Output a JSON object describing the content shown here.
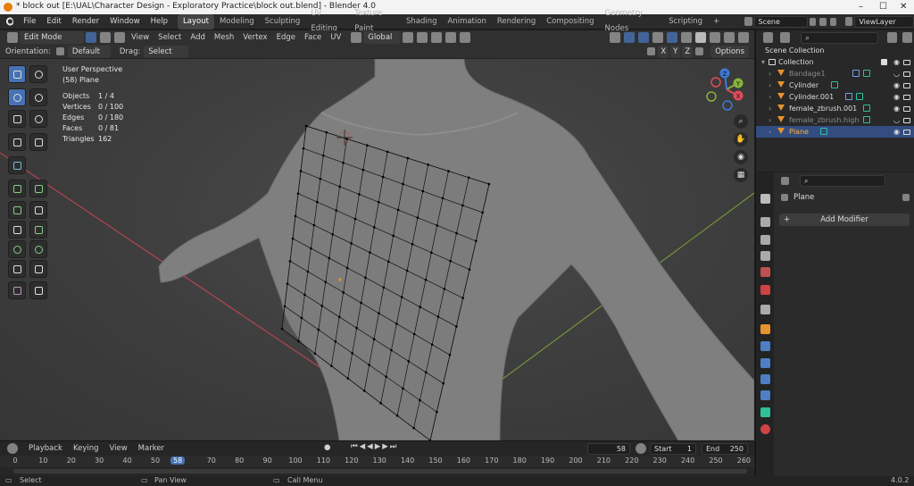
{
  "window": {
    "title": "* block out [E:\\UAL\\Character Design - Exploratory Practice\\block out.blend] - Blender 4.0"
  },
  "menu": {
    "items": [
      "File",
      "Edit",
      "Render",
      "Window",
      "Help"
    ]
  },
  "workspaces": {
    "tabs": [
      "Layout",
      "Modeling",
      "Sculpting",
      "UV Editing",
      "Texture Paint",
      "Shading",
      "Animation",
      "Rendering",
      "Compositing",
      "Geometry Nodes",
      "Scripting"
    ],
    "add": "+"
  },
  "scene": {
    "label": "Scene",
    "view_layer": "ViewLayer"
  },
  "viewport_header": {
    "mode": "Edit Mode",
    "menus": [
      "View",
      "Select",
      "Add",
      "Mesh",
      "Vertex",
      "Edge",
      "Face",
      "UV"
    ],
    "transform": "Global",
    "orientation_label": "Orientation:",
    "orientation": "Default",
    "drag_label": "Drag:",
    "drag": "Select Box",
    "options": "Options",
    "axes": [
      "X",
      "Y",
      "Z"
    ]
  },
  "overlay": {
    "view_name": "User Perspective",
    "object": "(58) Plane",
    "stats": [
      {
        "k": "Objects",
        "v": "1 / 4"
      },
      {
        "k": "Vertices",
        "v": "0 / 100"
      },
      {
        "k": "Edges",
        "v": "0 / 180"
      },
      {
        "k": "Faces",
        "v": "0 / 81"
      },
      {
        "k": "Triangles",
        "v": "162"
      }
    ]
  },
  "gizmo": {
    "x": "X",
    "y": "Y",
    "z": "Z"
  },
  "timeline": {
    "menus": [
      "Playback",
      "Keying",
      "View",
      "Marker"
    ],
    "current_frame": "58",
    "start_label": "Start",
    "start": "1",
    "end_label": "End",
    "end": "250",
    "ticks": [
      "0",
      "10",
      "20",
      "30",
      "40",
      "50",
      "70",
      "80",
      "90",
      "100",
      "110",
      "120",
      "130",
      "140",
      "150",
      "160",
      "170",
      "180",
      "190",
      "200",
      "210",
      "220",
      "230",
      "240",
      "250",
      "260"
    ]
  },
  "status": {
    "select": "Select",
    "pan": "Pan View",
    "call_menu": "Call Menu",
    "version": "4.0.2"
  },
  "outliner": {
    "root": "Scene Collection",
    "collection": "Collection",
    "items": [
      {
        "name": "Bandage1",
        "dim": true
      },
      {
        "name": "Cylinder",
        "dim": false
      },
      {
        "name": "Cylinder.001",
        "dim": false
      },
      {
        "name": "female_zbrush.001",
        "dim": false
      },
      {
        "name": "female_zbrush.high",
        "dim": true
      },
      {
        "name": "Plane",
        "dim": false,
        "selected": true
      }
    ]
  },
  "properties": {
    "object": "Plane",
    "add_modifier": "Add Modifier"
  },
  "colors": {
    "accent": "#4772b3",
    "x_axis": "#e04a5a",
    "y_axis": "#89b23a",
    "z_axis": "#3d78d6",
    "mesh_wire": "#111111"
  }
}
